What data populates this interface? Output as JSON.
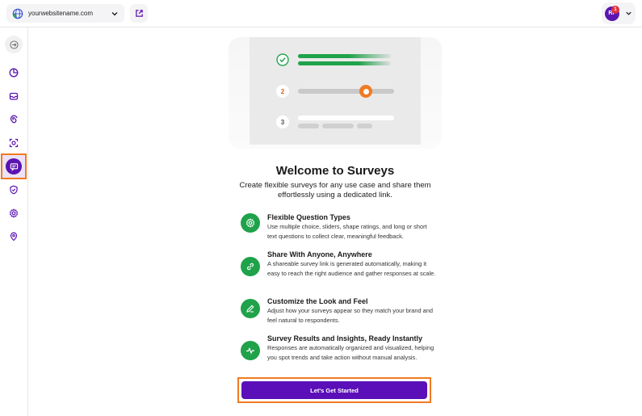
{
  "header": {
    "site_name": "yourwebsitename.com",
    "user_initials": "RF",
    "notification_count": "1"
  },
  "sidebar": {
    "items": [
      {
        "name": "analytics",
        "icon": "pie-chart-icon"
      },
      {
        "name": "inbox",
        "icon": "inbox-icon"
      },
      {
        "name": "tracking",
        "icon": "spiral-icon"
      },
      {
        "name": "feedback",
        "icon": "scan-icon"
      },
      {
        "name": "surveys",
        "icon": "survey-icon",
        "active": true
      },
      {
        "name": "security",
        "icon": "shield-icon"
      },
      {
        "name": "settings",
        "icon": "gear-icon"
      },
      {
        "name": "location",
        "icon": "location-pin-icon"
      }
    ]
  },
  "illustration": {
    "steps": [
      "2",
      "3"
    ]
  },
  "main": {
    "title": "Welcome to Surveys",
    "subtitle": "Create flexible surveys for any use case and share them effortlessly using a dedicated link.",
    "features": [
      {
        "icon": "gear-icon",
        "title": "Flexible Question Types",
        "description": "Use multiple choice, sliders, shape ratings, and long or short text questions to collect clear, meaningful feedback."
      },
      {
        "icon": "link-icon",
        "title": "Share With Anyone, Anywhere",
        "description": "A shareable survey link is generated automatically, making it easy to reach the right audience and gather responses at scale."
      },
      {
        "icon": "pencil-icon",
        "title": "Customize the Look and Feel",
        "description": "Adjust how your surveys appear so they match your brand and feel natural to respondents."
      },
      {
        "icon": "pulse-icon",
        "title": "Survey Results and Insights, Ready Instantly",
        "description": "Responses are automatically organized and visualized, helping you spot trends and take action without manual analysis."
      }
    ],
    "cta_label": "Let's Get Started"
  },
  "colors": {
    "brand_purple": "#5b0fb8",
    "accent_orange": "#f07a22",
    "success_green": "#1fa24a"
  }
}
